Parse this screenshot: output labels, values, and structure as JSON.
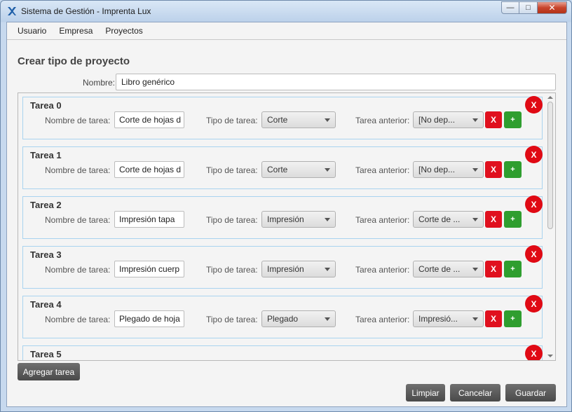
{
  "window": {
    "title": "Sistema de Gestión - Imprenta Lux"
  },
  "menu": {
    "items": [
      "Usuario",
      "Empresa",
      "Proyectos"
    ]
  },
  "page": {
    "title": "Crear tipo de proyecto"
  },
  "form": {
    "name_label": "Nombre:",
    "name_value": "Libro genérico"
  },
  "labels": {
    "task_name": "Nombre de tarea:",
    "task_type": "Tipo de tarea:",
    "prev_task": "Tarea anterior:"
  },
  "buttons": {
    "remove_x": "X",
    "add_plus": "+",
    "add_task": "Agregar tarea",
    "clear": "Limpiar",
    "cancel": "Cancelar",
    "save": "Guardar"
  },
  "tasks": [
    {
      "title": "Tarea 0",
      "name": "Corte de hojas d",
      "type": "Corte",
      "previous": "[No dep..."
    },
    {
      "title": "Tarea 1",
      "name": "Corte de hojas d",
      "type": "Corte",
      "previous": "[No dep..."
    },
    {
      "title": "Tarea 2",
      "name": "Impresión tapa",
      "type": "Impresión",
      "previous": "Corte de ..."
    },
    {
      "title": "Tarea 3",
      "name": "Impresión cuerp",
      "type": "Impresión",
      "previous": "Corte de ..."
    },
    {
      "title": "Tarea 4",
      "name": "Plegado de hoja",
      "type": "Plegado",
      "previous": "Impresió..."
    },
    {
      "title": "Tarea 5"
    }
  ],
  "colors": {
    "remove": "#e0101e",
    "add": "#2f9e2f",
    "task_border": "#a9d3ef",
    "dark_button": "#555555"
  }
}
